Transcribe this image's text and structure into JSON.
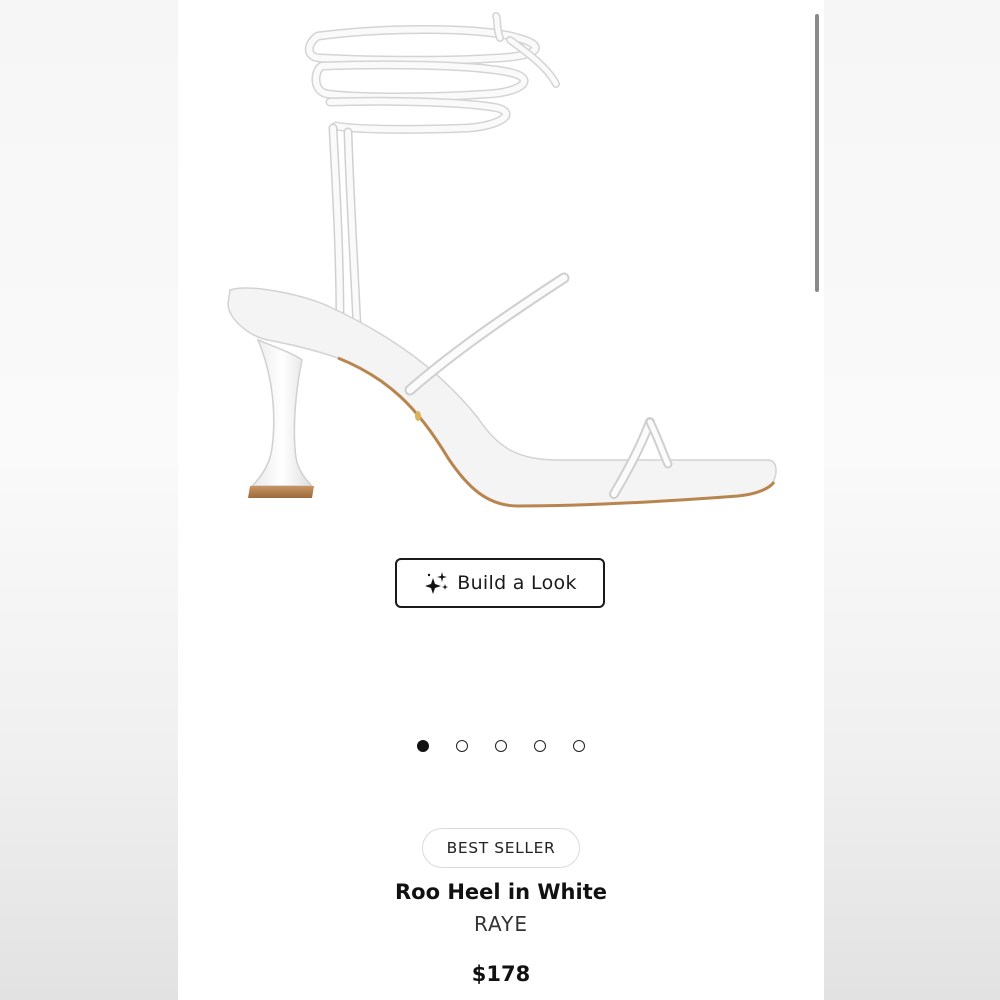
{
  "product": {
    "image_alt": "White strappy lace-up heeled sandal",
    "build_look_label": "Build a Look",
    "build_look_icon": "sparkle-icon",
    "badge": "BEST SELLER",
    "name": "Roo Heel in White",
    "brand": "RAYE",
    "price": "$178"
  },
  "carousel": {
    "total_slides": 5,
    "active_index": 0
  },
  "colors": {
    "text": "#111111",
    "badge_border": "#dadada",
    "heel_wood": "#b07a48"
  }
}
